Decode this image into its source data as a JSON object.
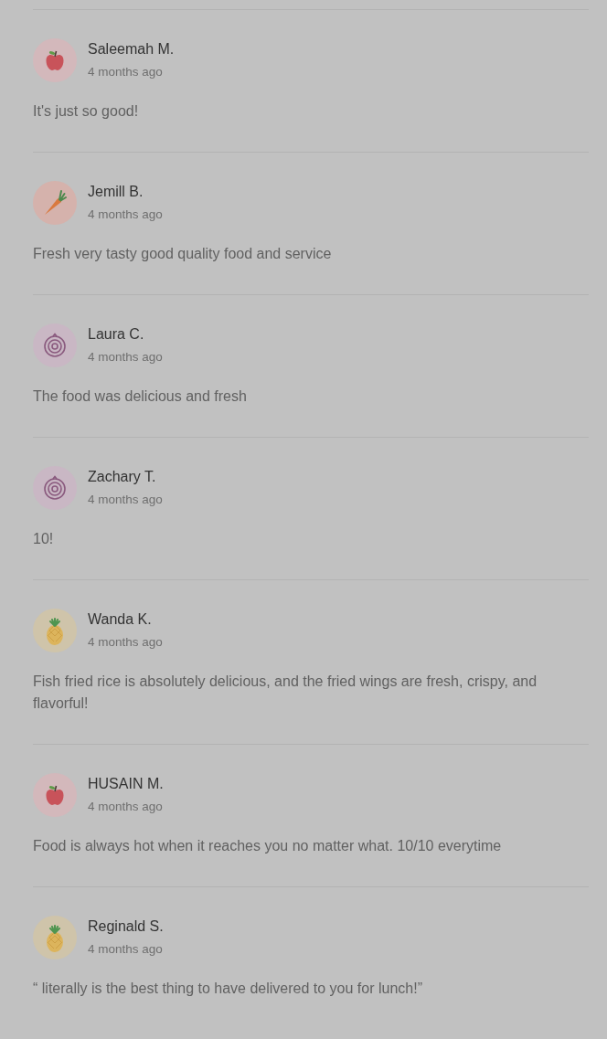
{
  "reviews": [
    {
      "avatar": {
        "kind": "apple"
      },
      "name": "Saleemah M.",
      "time": "4 months ago",
      "text": "It's just so good!"
    },
    {
      "avatar": {
        "kind": "carrot"
      },
      "name": "Jemill B.",
      "time": "4 months ago",
      "text": "Fresh very tasty good quality food and service"
    },
    {
      "avatar": {
        "kind": "onion"
      },
      "name": "Laura C.",
      "time": "4 months ago",
      "text": "The food was delicious and fresh"
    },
    {
      "avatar": {
        "kind": "onion"
      },
      "name": "Zachary T.",
      "time": "4 months ago",
      "text": "10!"
    },
    {
      "avatar": {
        "kind": "pineapple"
      },
      "name": "Wanda K.",
      "time": "4 months ago",
      "text": "Fish fried rice is absolutely delicious, and the fried wings are fresh, crispy, and flavorful!"
    },
    {
      "avatar": {
        "kind": "apple"
      },
      "name": "HUSAIN M.",
      "time": "4 months ago",
      "text": "Food is always hot when it reaches you no matter what. 10/10 everytime"
    },
    {
      "avatar": {
        "kind": "pineapple"
      },
      "name": "Reginald S.",
      "time": "4 months ago",
      "text": "“ literally is the best thing to have delivered to you for lunch!”"
    }
  ]
}
